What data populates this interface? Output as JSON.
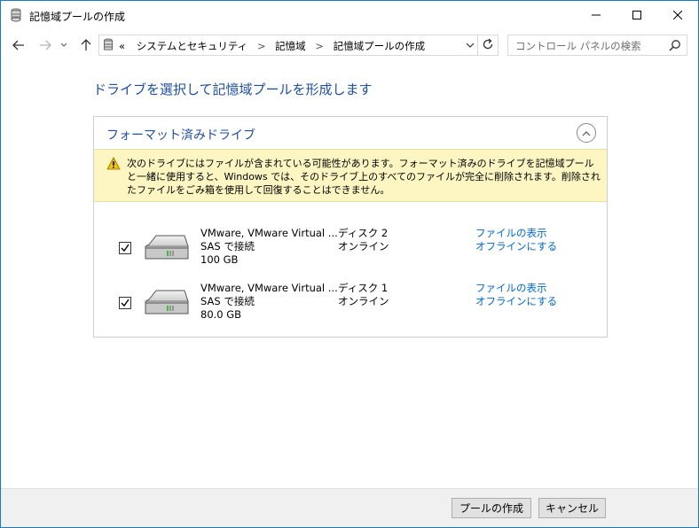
{
  "window": {
    "title": "記憶域プールの作成"
  },
  "nav": {
    "breadcrumb": {
      "prefix": "«",
      "items": [
        "システムとセキュリティ",
        "記憶域",
        "記憶域プールの作成"
      ],
      "separator": ">"
    },
    "search_placeholder": "コントロール パネルの検索"
  },
  "main": {
    "heading": "ドライブを選択して記憶域プールを形成します",
    "section": {
      "title": "フォーマット済みドライブ",
      "warning": "次のドライブにはファイルが含まれている可能性があります。フォーマット済みのドライブを記憶域プールと一緒に使用すると、Windows では、そのドライブ上のすべてのファイルが完全に削除されます。削除されたファイルをごみ箱を使用して回復することはできません。",
      "drives": [
        {
          "checked": true,
          "name": "VMware, VMware Virtual ...",
          "connection": "SAS で接続",
          "size": "100 GB",
          "disk": "ディスク 2",
          "state": "オンライン",
          "link_view": "ファイルの表示",
          "link_offline": "オフラインにする"
        },
        {
          "checked": true,
          "name": "VMware, VMware Virtual ...",
          "connection": "SAS で接続",
          "size": "80.0 GB",
          "disk": "ディスク 1",
          "state": "オンライン",
          "link_view": "ファイルの表示",
          "link_offline": "オフラインにする"
        }
      ]
    }
  },
  "footer": {
    "create_label": "プールの作成",
    "cancel_label": "キャンセル"
  },
  "colors": {
    "heading": "#1e4e9e",
    "link": "#0066cc",
    "warning_bg": "#fdf6c3",
    "window_border": "#1979ca"
  }
}
